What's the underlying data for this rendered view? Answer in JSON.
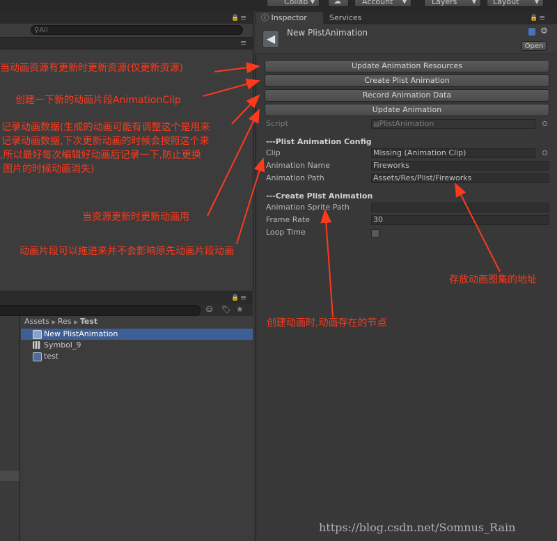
{
  "toolbar": {
    "collab": "Collab",
    "account": "Account",
    "layers": "Layers",
    "layout": "Layout"
  },
  "hierarchy": {
    "search_placeholder": "All"
  },
  "project": {
    "breadcrumb": [
      "Assets",
      "Res",
      "Test"
    ],
    "assets": [
      {
        "name": "New PlistAnimation",
        "selected": true,
        "icon": "animation-asset-icon"
      },
      {
        "name": "Symbol_9",
        "selected": false,
        "icon": "sprite-grid-icon"
      },
      {
        "name": "test",
        "selected": false,
        "icon": "play-asset-icon"
      }
    ]
  },
  "inspector": {
    "tab_inspector": "Inspector",
    "tab_services": "Services",
    "object_title": "New PlistAnimation",
    "open_label": "Open",
    "buttons": {
      "update_resources": "Update Animation Resources",
      "create_plist": "Create Plist Animation",
      "record_data": "Record Animation Data",
      "update_animation": "Update Animation"
    },
    "script_label": "Script",
    "script_value": "PlistAnimation",
    "config_header": "---Plist Animation Config",
    "clip_label": "Clip",
    "clip_value": "Missing (Animation Clip)",
    "anim_name_label": "Animation Name",
    "anim_name_value": "Fireworks",
    "anim_path_label": "Animation Path",
    "anim_path_value": "Assets/Res/Plist/Fireworks",
    "create_header": "---Create Plist Animation",
    "sprite_path_label": "Animation Sprite Path",
    "sprite_path_value": "",
    "frame_rate_label": "Frame Rate",
    "frame_rate_value": "30",
    "loop_time_label": "Loop Time",
    "loop_time_checked": false
  },
  "annotations": {
    "n1": "当动画资源有更新时更新资源(仅更新资源)",
    "n2": "创建一下新的动画片段AnimationCilp",
    "n3_line1": "记录动画数据(生成的动画可能有调整这个是用来",
    "n3_line2": "记录动画数据,下次更新动画的时候会按照这个来",
    "n3_line3": ",所以最好每次编辑好动画后记录一下,防止更换",
    "n3_line4": "图片的时候动画消失)",
    "n4": "当资源更新时更新动画用",
    "n5": "动画片段可以拖进来并不会影响原先动画片段动画",
    "n6": "存放动画图集的地址",
    "n7": "创建动画时,动画存在的节点"
  },
  "watermark": "https://blog.csdn.net/Somnus_Rain",
  "colors": {
    "annotation_red": "#ff3a1c",
    "selection_blue": "#3e5f96",
    "panel_bg": "#383838"
  }
}
